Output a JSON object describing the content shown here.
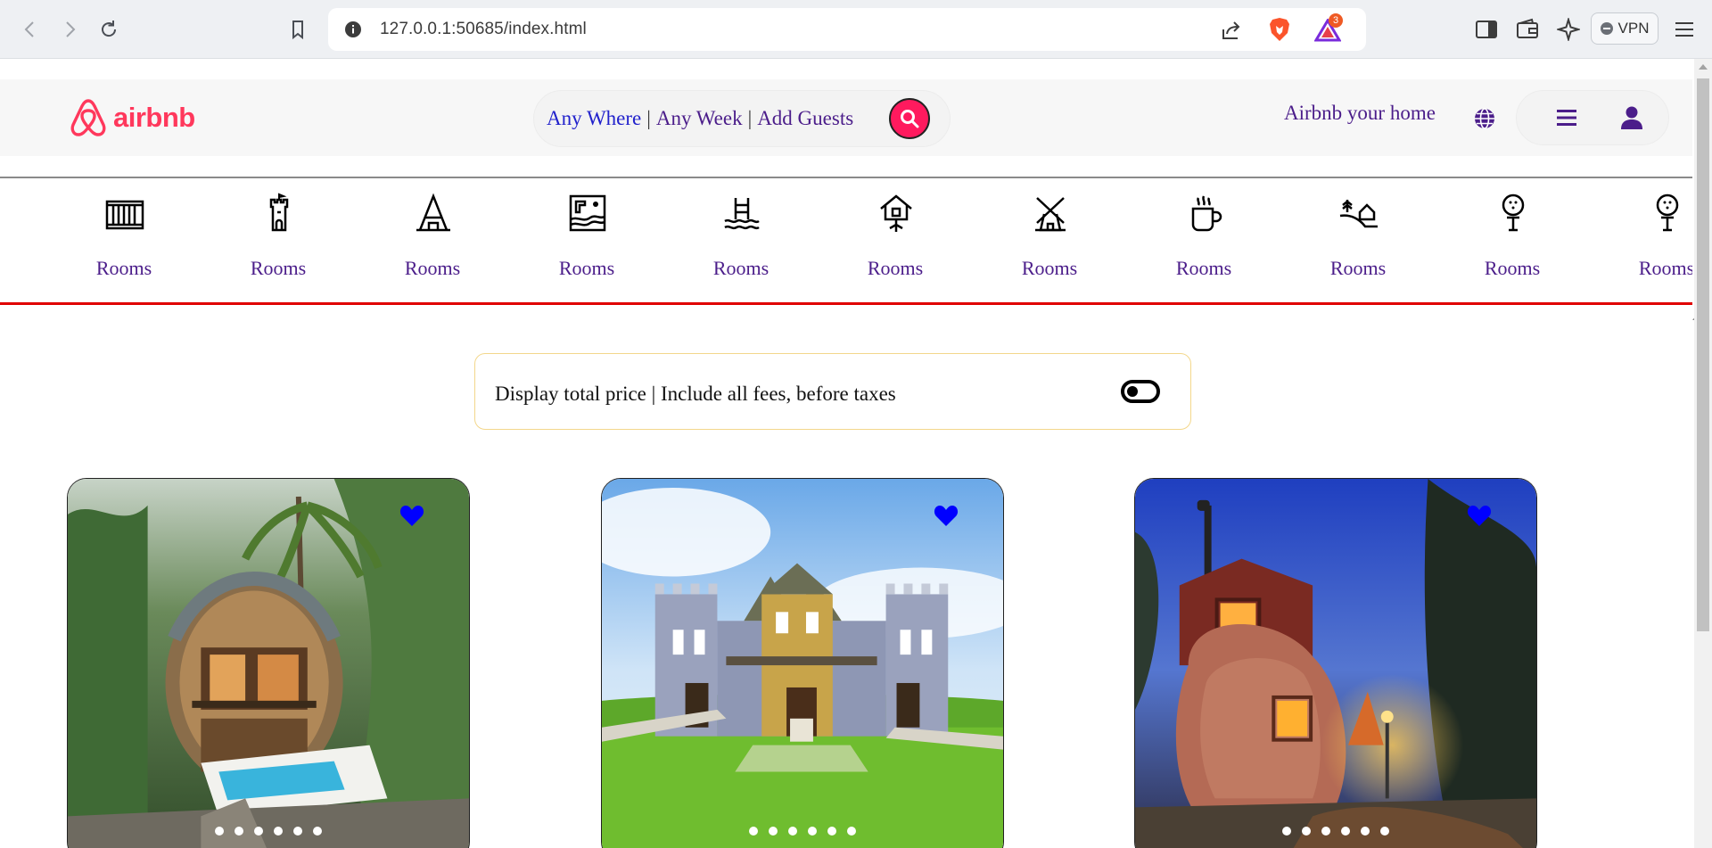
{
  "browser": {
    "url": "127.0.0.1:50685/index.html",
    "rewards_count": "3",
    "vpn_label": "VPN"
  },
  "header": {
    "logo_text": "airbnb",
    "search": {
      "anywhere": "Any Where",
      "anyweek": "Any Week",
      "guests": "Add Guests",
      "separator": "|"
    },
    "host_link": "Airbnb your home"
  },
  "categories": [
    {
      "label": "Rooms",
      "icon": "rooms-icon"
    },
    {
      "label": "Rooms",
      "icon": "castle-icon"
    },
    {
      "label": "Rooms",
      "icon": "a-frame-icon"
    },
    {
      "label": "Rooms",
      "icon": "beach-map-icon"
    },
    {
      "label": "Rooms",
      "icon": "pool-icon"
    },
    {
      "label": "Rooms",
      "icon": "treehouse-icon"
    },
    {
      "label": "Rooms",
      "icon": "windmill-icon"
    },
    {
      "label": "Rooms",
      "icon": "coffee-icon"
    },
    {
      "label": "Rooms",
      "icon": "countryside-icon"
    },
    {
      "label": "Rooms",
      "icon": "golf-icon"
    },
    {
      "label": "Rooms",
      "icon": "golf-icon"
    }
  ],
  "price_toggle": {
    "text": "Display total price | Include all fees, before taxes",
    "enabled": false
  },
  "listings": [
    {
      "photo": "dome-house-jungle-photo",
      "dots": 6,
      "favorite_color": "#0000ff"
    },
    {
      "photo": "castle-mansion-photo",
      "dots": 6,
      "favorite_color": "#0000ff"
    },
    {
      "photo": "shoe-house-night-photo",
      "dots": 6,
      "favorite_color": "#0000ff"
    }
  ],
  "colors": {
    "brand": "#ff385c",
    "search_button": "#ff1a5e",
    "nav_text": "#4b1d8a",
    "category_border": "#e00000"
  }
}
